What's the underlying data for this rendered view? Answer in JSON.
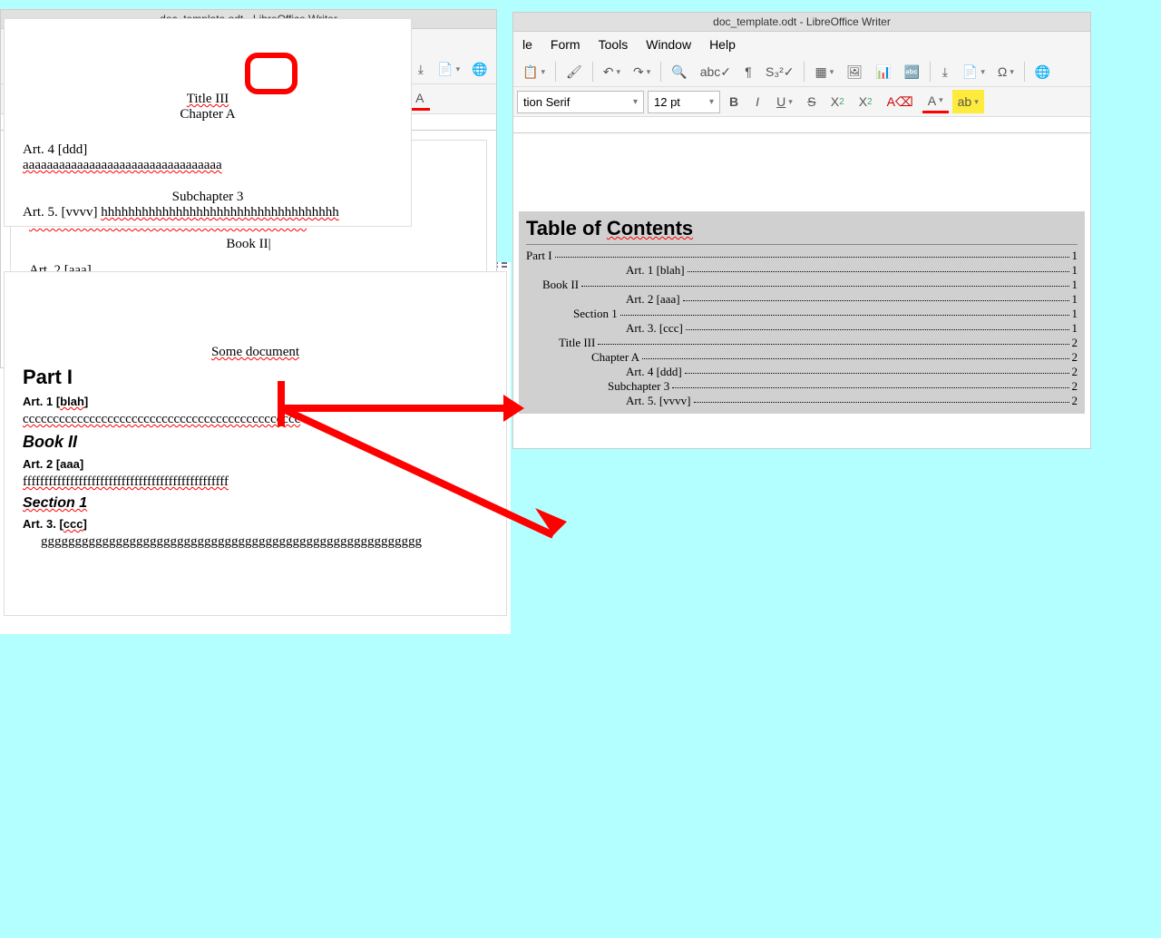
{
  "app_title": "doc_template.odt - LibreOffice Writer",
  "menus": {
    "le": "le",
    "form": "Form",
    "tools": "Tools",
    "window": "Window",
    "help": "Help"
  },
  "font_name": "tion Serif",
  "font_size": "12 pt",
  "doc1": {
    "title": "Some document",
    "part1": "Part I",
    "art1": "Art. 1 [blah]",
    "c_line": "cccccccccccccccccccccccccccccccccccccccccccccc",
    "book2": "Book II",
    "art2": "Art. 2 [aaa]",
    "f_line": "ffffffffffffffffffffffffffffffffffffffffffffffff",
    "section1": "Section 1",
    "art3": "Art. 3.  [ccc]",
    "g_line": "ggggggggggggggggggggggggggggggggggggggggggggggggggg"
  },
  "doc2": {
    "title3": "Title III",
    "chapterA": "Chapter A",
    "art4": "Art. 4 [ddd]",
    "a_line": "aaaaaaaaaaaaaaaaaaaaaaaaaaaaaaaaa",
    "subchapter3": "Subchapter 3",
    "art5": "Art. 5. [vvvv]",
    "h_line": "hhhhhhhhhhhhhhhhhhhhhhhhhhhhhhhhhhh"
  },
  "toc": {
    "title": "Table of Contents",
    "rows": [
      {
        "label": "Part I",
        "pg": "1",
        "indent": 0
      },
      {
        "label": "Art. 1 [blah]",
        "pg": "1",
        "indent": 110
      },
      {
        "label": "Book II",
        "pg": "1",
        "indent": 18
      },
      {
        "label": "Art. 2 [aaa]",
        "pg": "1",
        "indent": 110
      },
      {
        "label": "Section 1",
        "pg": "1",
        "indent": 52
      },
      {
        "label": "Art. 3. [ccc]",
        "pg": "1",
        "indent": 110
      },
      {
        "label": "Title III",
        "pg": "2",
        "indent": 36
      },
      {
        "label": "Chapter A",
        "pg": "2",
        "indent": 72
      },
      {
        "label": "Art. 4 [ddd]",
        "pg": "2",
        "indent": 110
      },
      {
        "label": "Subchapter 3",
        "pg": "2",
        "indent": 90
      },
      {
        "label": "Art. 5. [vvvv]",
        "pg": "2",
        "indent": 110
      }
    ]
  },
  "doc4": {
    "title": "Some document",
    "part1": "Part I",
    "art1": "Art. 1 [blah]",
    "c_line": "cccccccccccccccccccccccccccccccccccccccccccccc",
    "book2": "Book II",
    "art2": "Art. 2 [aaa]",
    "f_line": "ffffffffffffffffffffffffffffffffffffffffffffffff",
    "section1": "Section 1",
    "art3": "Art. 3.  [ccc]",
    "g_line": "gggggggggggggggggggggggggggggggggggggggggggggggggggggggg"
  }
}
